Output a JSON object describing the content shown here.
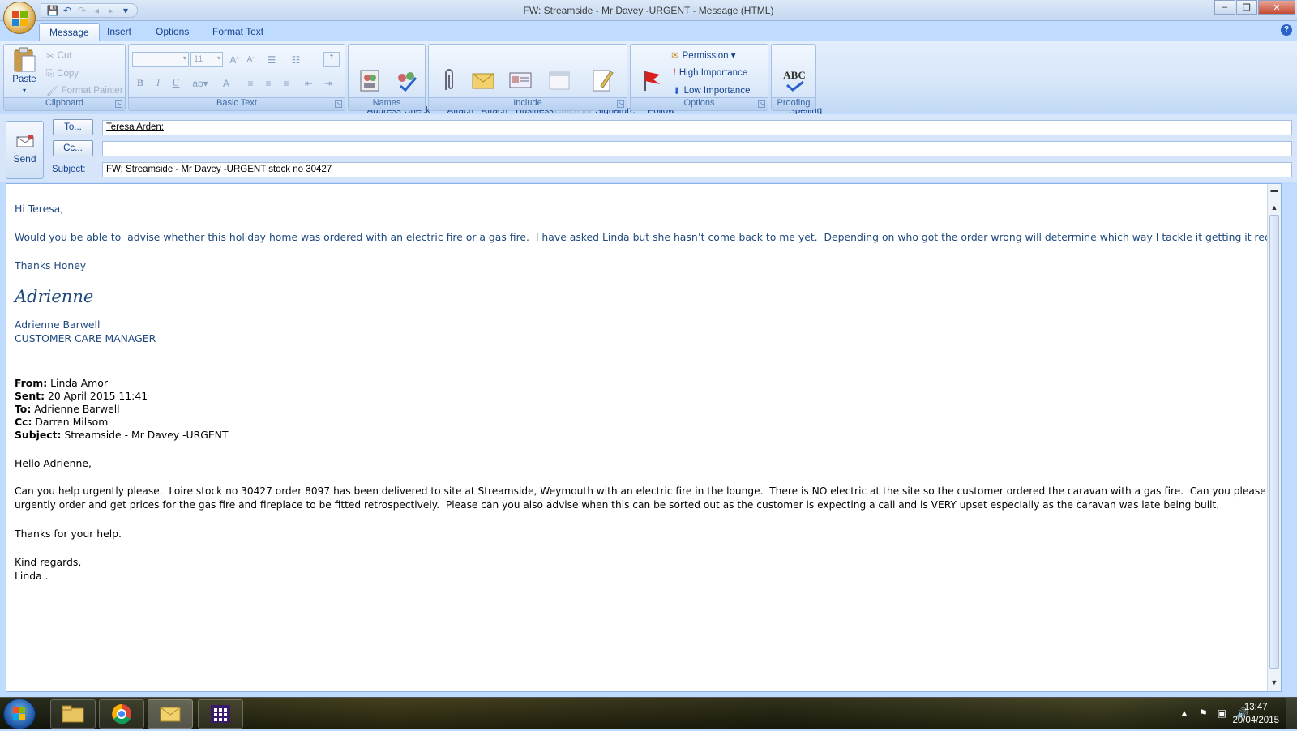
{
  "window": {
    "title": "FW: Streamside - Mr Davey -URGENT - Message (HTML)",
    "controls": {
      "minimize": "‒",
      "restore": "❐",
      "close": "✕"
    }
  },
  "quick_access": [
    "save-icon",
    "undo-icon",
    "redo-icon",
    "up-icon",
    "down-icon",
    "customize-icon"
  ],
  "tabs": [
    {
      "label": "Message",
      "active": true
    },
    {
      "label": "Insert",
      "active": false
    },
    {
      "label": "Options",
      "active": false
    },
    {
      "label": "Format Text",
      "active": false
    }
  ],
  "help_label": "?",
  "ribbon": {
    "clipboard": {
      "group_label": "Clipboard",
      "paste": "Paste",
      "cut": "Cut",
      "copy": "Copy",
      "format_painter": "Format Painter"
    },
    "basic_text": {
      "group_label": "Basic Text",
      "font_size": "11",
      "bold": "B",
      "italic": "I",
      "underline": "U"
    },
    "names": {
      "group_label": "Names",
      "address_book": "Address\nBook",
      "check_names": "Check\nNames"
    },
    "include": {
      "group_label": "Include",
      "attach_file": "Attach\nFile",
      "attach_item": "Attach\nItem",
      "business_card": "Business\nCard ▾",
      "calendar": "Calendar",
      "signature": "Signature\n▾"
    },
    "options": {
      "group_label": "Options",
      "follow_up": "Follow\nUp ▾",
      "permission": "Permission ▾",
      "high_importance": "High Importance",
      "low_importance": "Low Importance"
    },
    "proofing": {
      "group_label": "Proofing",
      "spelling": "Spelling\n▾",
      "abc": "ABC"
    }
  },
  "header": {
    "send": "Send",
    "to_button": "To...",
    "cc_button": "Cc...",
    "subject_label": "Subject:",
    "to_value": "Teresa Arden;",
    "cc_value": "",
    "subject_value": "FW: Streamside - Mr Davey -URGENT  stock no 30427"
  },
  "message": {
    "greeting": "Hi Teresa,",
    "para1": "Would you be able to  advise whether this holiday home was ordered with an electric fire or a gas fire.  I have asked Linda but she hasn’t come back to me yet.  Depending on who got the order wrong will determine which way I tackle it getting it rectified.",
    "thanks": "Thanks Honey",
    "signature_script": "Adrienne",
    "sig_name": "Adrienne Barwell",
    "sig_title": "CUSTOMER CARE MANAGER",
    "forwarded": {
      "from_label": "From:",
      "from": " Linda Amor",
      "sent_label": "Sent:",
      "sent": " 20 April 2015 11:41",
      "to_label": "To:",
      "to": " Adrienne Barwell",
      "cc_label": "Cc:",
      "cc": " Darren Milsom",
      "subject_label": "Subject:",
      "subject": " Streamside - Mr Davey -URGENT",
      "greeting": "Hello Adrienne,",
      "line1": "Can you help urgently please.  Loire stock no 30427 order 8097 has been delivered to site at Streamside, Weymouth with an electric fire in the lounge.  There is NO electric at the site so the customer ordered the caravan with a gas fire.  Can you please",
      "line2": "urgently order and get prices for the gas fire and fireplace to be fitted retrospectively.  Please can you also advise when this can be sorted out as the customer is expecting a call and is VERY upset especially as the caravan was late being built.",
      "thanks": "Thanks for your help.",
      "regards": "Kind regards,",
      "name": "Linda ."
    }
  },
  "taskbar": {
    "time": "13:47",
    "date": "20/04/2015",
    "apps": [
      "file-explorer-icon",
      "chrome-icon",
      "outlook-icon",
      "app-grid-icon"
    ]
  }
}
